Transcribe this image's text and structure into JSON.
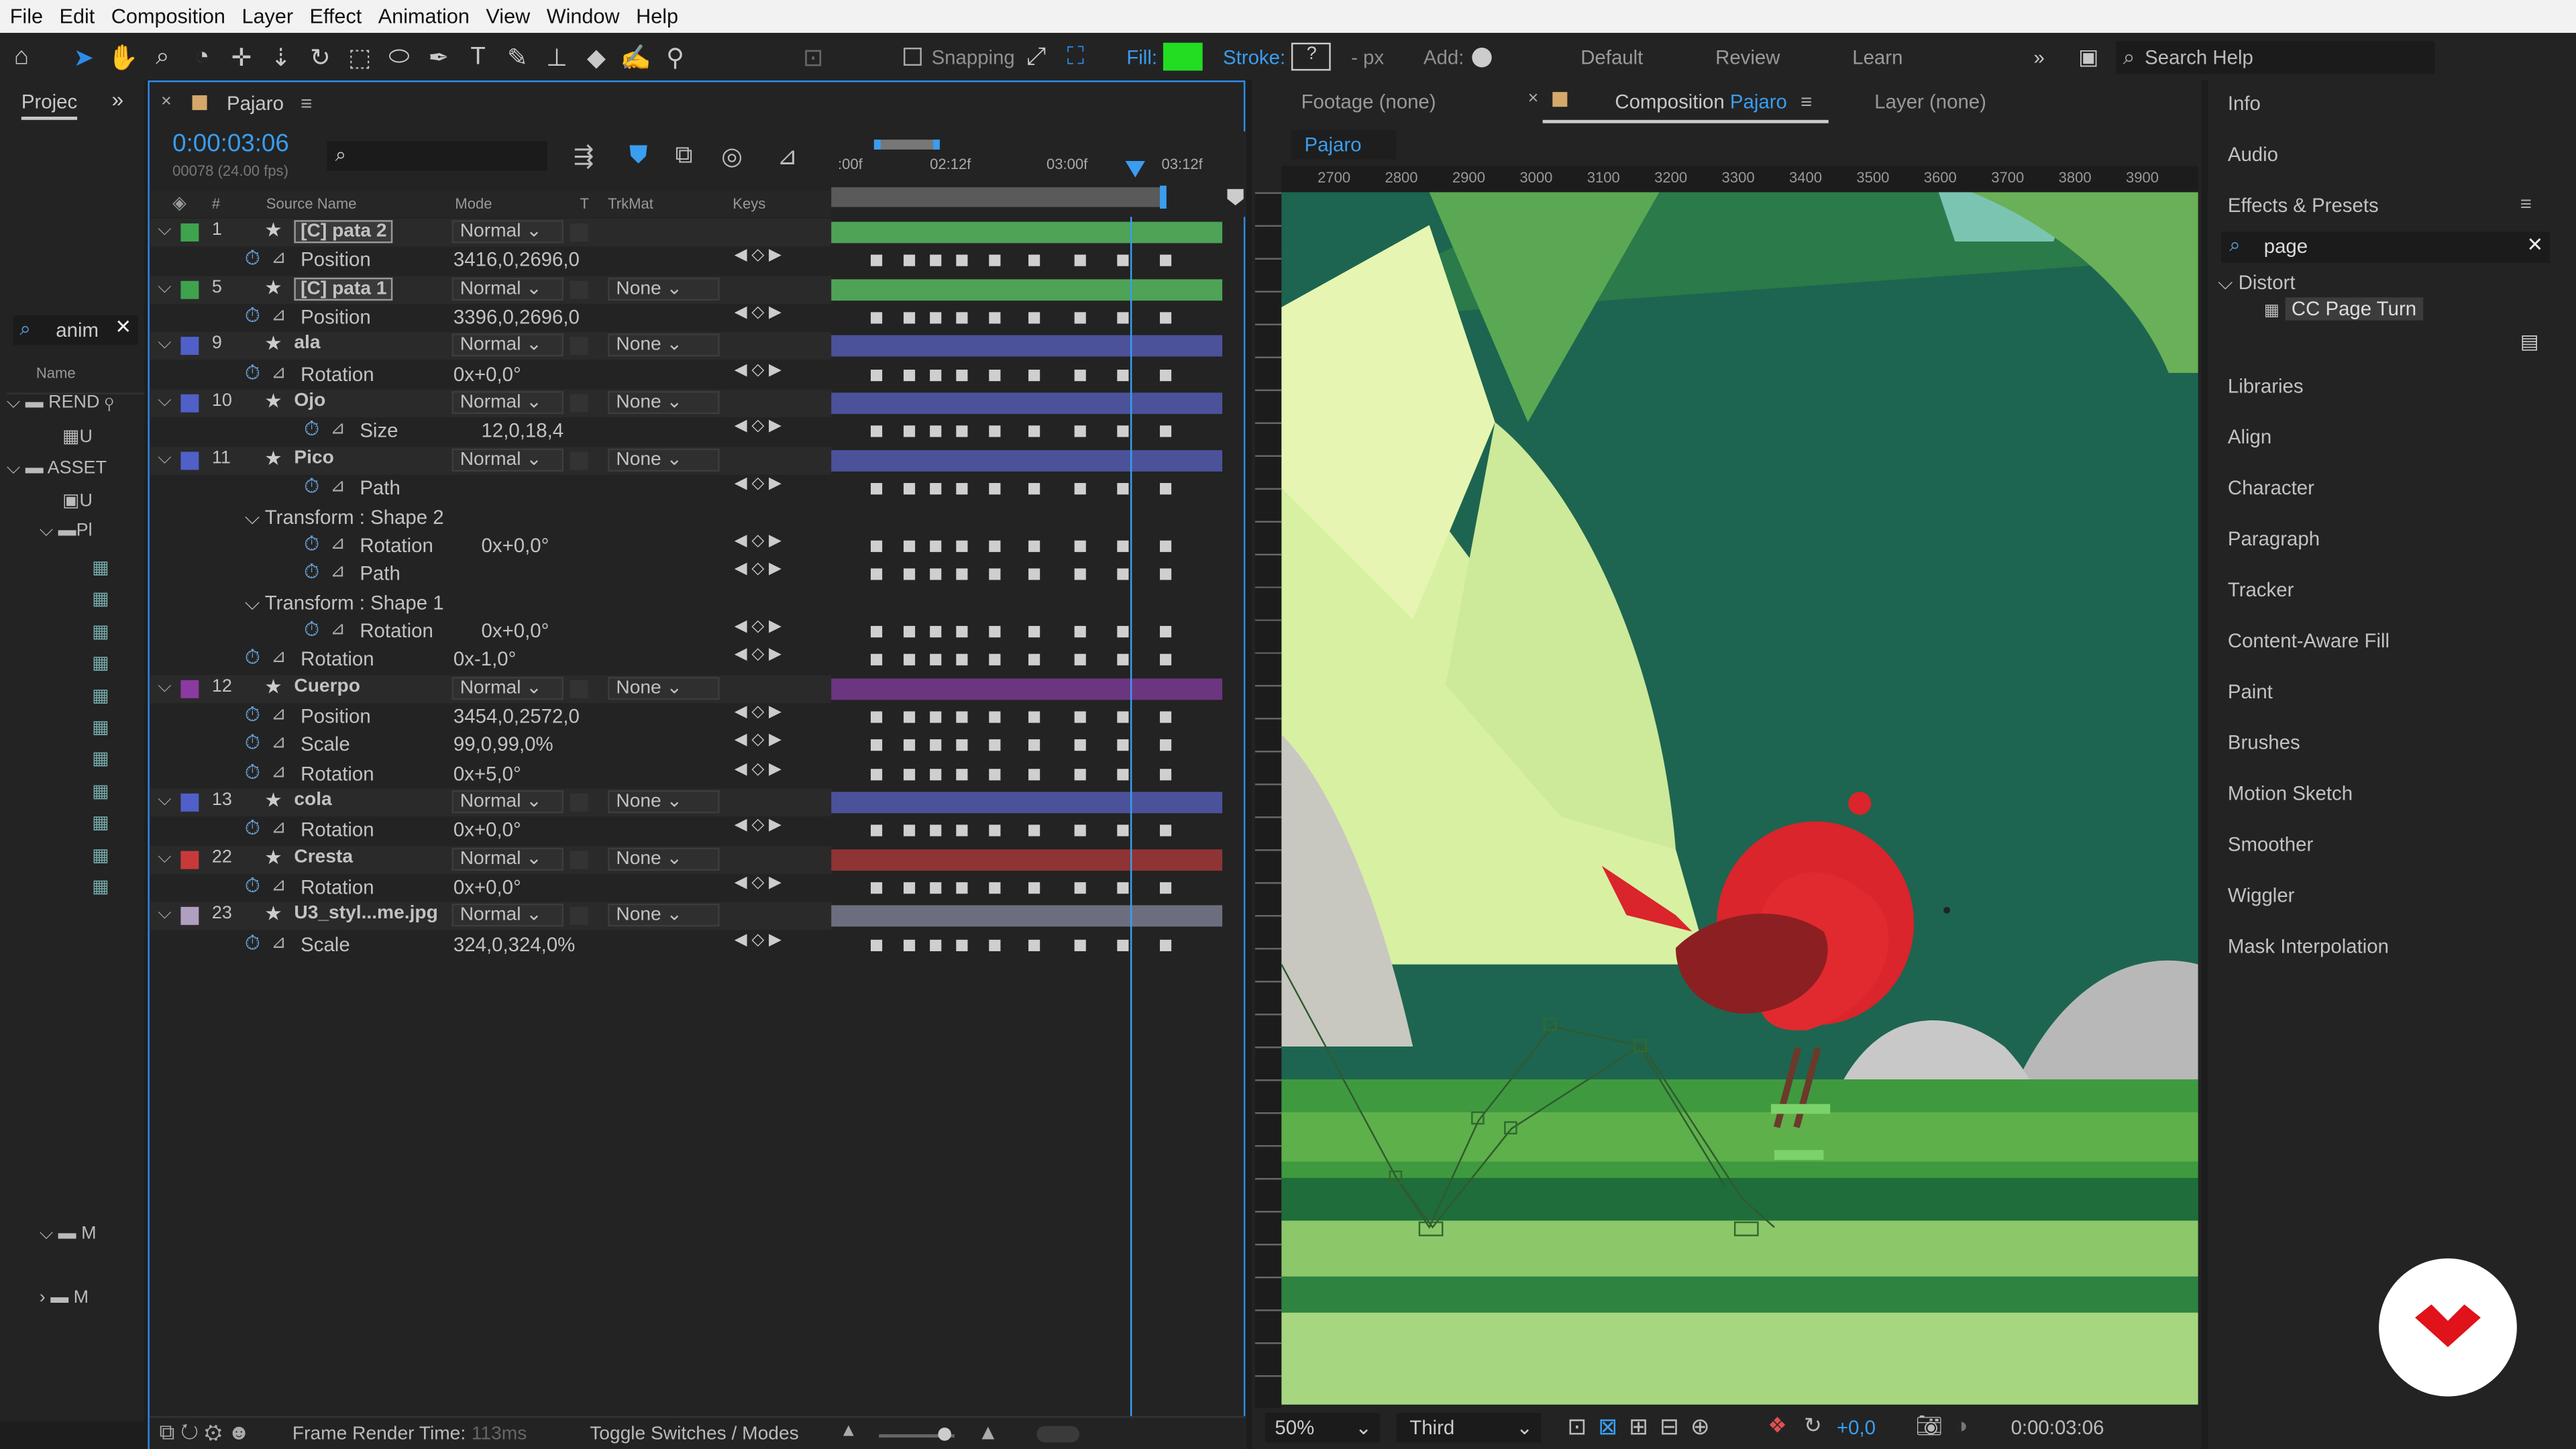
{
  "menu": [
    "File",
    "Edit",
    "Composition",
    "Layer",
    "Effect",
    "Animation",
    "View",
    "Window",
    "Help"
  ],
  "toolbar": {
    "snapping_label": "Snapping",
    "fill_label": "Fill:",
    "fill_color": "#22dd22",
    "stroke_label": "Stroke:",
    "stroke_value": "?",
    "px_label": "- px",
    "add_label": "Add:",
    "workspaces": [
      "Default",
      "Review",
      "Learn"
    ],
    "search_help": "Search Help"
  },
  "project": {
    "tab_label": "Projec",
    "search_value": "anim",
    "name_header": "Name",
    "items": [
      "REND",
      "U",
      "ASSET",
      "U",
      "Pl",
      "M",
      "M"
    ]
  },
  "timeline": {
    "comp_name": "Pajaro",
    "timecode": "0:00:03:06",
    "frame_info": "00078 (24.00 fps)",
    "headers": {
      "num": "#",
      "source": "Source Name",
      "mode": "Mode",
      "t": "T",
      "trkmat": "TrkMat",
      "keys": "Keys"
    },
    "ruler": [
      ":00f",
      "02:12f",
      "03:00f",
      "03:12f"
    ],
    "rows": [
      {
        "kind": "layer",
        "num": "1",
        "name": "pata 2",
        "color": "#3fa34d",
        "mode": "Normal",
        "trk": "",
        "bar": "#4ea356"
      },
      {
        "kind": "prop",
        "name": "Position",
        "value": "3416,0,2696,0",
        "indent": 1
      },
      {
        "kind": "layer",
        "num": "5",
        "name": "pata 1",
        "color": "#3fa34d",
        "mode": "Normal",
        "trk": "None",
        "bar": "#4ea356"
      },
      {
        "kind": "prop",
        "name": "Position",
        "value": "3396,0,2696,0",
        "indent": 1
      },
      {
        "kind": "layer",
        "num": "9",
        "name": "ala",
        "color": "#5060c8",
        "mode": "Normal",
        "trk": "None",
        "bar": "#4b529a"
      },
      {
        "kind": "prop",
        "name": "Rotation",
        "value": "0x+0,0°",
        "indent": 1
      },
      {
        "kind": "layer",
        "num": "10",
        "name": "Ojo",
        "color": "#5060c8",
        "mode": "Normal",
        "trk": "None",
        "bar": "#4b529a"
      },
      {
        "kind": "prop",
        "name": "Size",
        "value": "12,0,18,4",
        "indent": 2
      },
      {
        "kind": "layer",
        "num": "11",
        "name": "Pico",
        "color": "#5060c8",
        "mode": "Normal",
        "trk": "None",
        "bar": "#4b529a"
      },
      {
        "kind": "prop",
        "name": "Path",
        "value": "",
        "indent": 2
      },
      {
        "kind": "group",
        "name": "Transform : Shape 2"
      },
      {
        "kind": "prop",
        "name": "Rotation",
        "value": "0x+0,0°",
        "indent": 2
      },
      {
        "kind": "prop",
        "name": "Path",
        "value": "",
        "indent": 2
      },
      {
        "kind": "group",
        "name": "Transform : Shape 1"
      },
      {
        "kind": "prop",
        "name": "Rotation",
        "value": "0x+0,0°",
        "indent": 2
      },
      {
        "kind": "prop",
        "name": "Rotation",
        "value": "0x-1,0°",
        "indent": 1
      },
      {
        "kind": "layer",
        "num": "12",
        "name": "Cuerpo",
        "color": "#8a3aa0",
        "mode": "Normal",
        "trk": "None",
        "bar": "#6c3580"
      },
      {
        "kind": "prop",
        "name": "Position",
        "value": "3454,0,2572,0",
        "indent": 1
      },
      {
        "kind": "prop",
        "name": "Scale",
        "value": "99,0,99,0%",
        "indent": 1
      },
      {
        "kind": "prop",
        "name": "Rotation",
        "value": "0x+5,0°",
        "indent": 1
      },
      {
        "kind": "layer",
        "num": "13",
        "name": "cola",
        "color": "#5060c8",
        "mode": "Normal",
        "trk": "None",
        "bar": "#4b529a"
      },
      {
        "kind": "prop",
        "name": "Rotation",
        "value": "0x+0,0°",
        "indent": 1
      },
      {
        "kind": "layer",
        "num": "22",
        "name": "Cresta",
        "color": "#c83a3a",
        "mode": "Normal",
        "trk": "None",
        "bar": "#8e3434"
      },
      {
        "kind": "prop",
        "name": "Rotation",
        "value": "0x+0,0°",
        "indent": 1
      },
      {
        "kind": "layer",
        "num": "23",
        "name": "U3_styl...me.jpg",
        "color": "#b0a0c0",
        "mode": "Normal",
        "trk": "None",
        "bar": "#6d6d80"
      },
      {
        "kind": "prop",
        "name": "Scale",
        "value": "324,0,324,0%",
        "indent": 1
      }
    ],
    "footer_render_label": "Frame Render Time:",
    "footer_render_value": "113ms",
    "footer_toggle": "Toggle Switches / Modes"
  },
  "viewer": {
    "tabs": {
      "footage": "Footage (none)",
      "comp_prefix": "Composition",
      "comp_name": "Pajaro",
      "layer": "Layer (none)"
    },
    "sub_tab": "Pajaro",
    "ruler": [
      "2700",
      "2800",
      "2900",
      "3000",
      "3100",
      "3200",
      "3300",
      "3400",
      "3500",
      "3600",
      "3700",
      "3800",
      "3900"
    ],
    "zoom": "50%",
    "resolution": "Third",
    "exposure": "+0,0",
    "timecode": "0:00:03:06"
  },
  "right_panel": {
    "items_top": [
      "Info",
      "Audio"
    ],
    "effects_title": "Effects & Presets",
    "search_value": "page",
    "category": "Distort",
    "effect": "CC Page Turn",
    "items_bottom": [
      "Libraries",
      "Align",
      "Character",
      "Paragraph",
      "Tracker",
      "Content-Aware Fill",
      "Paint",
      "Brushes",
      "Motion Sketch",
      "Smoother",
      "Wiggler",
      "Mask Interpolation"
    ]
  }
}
